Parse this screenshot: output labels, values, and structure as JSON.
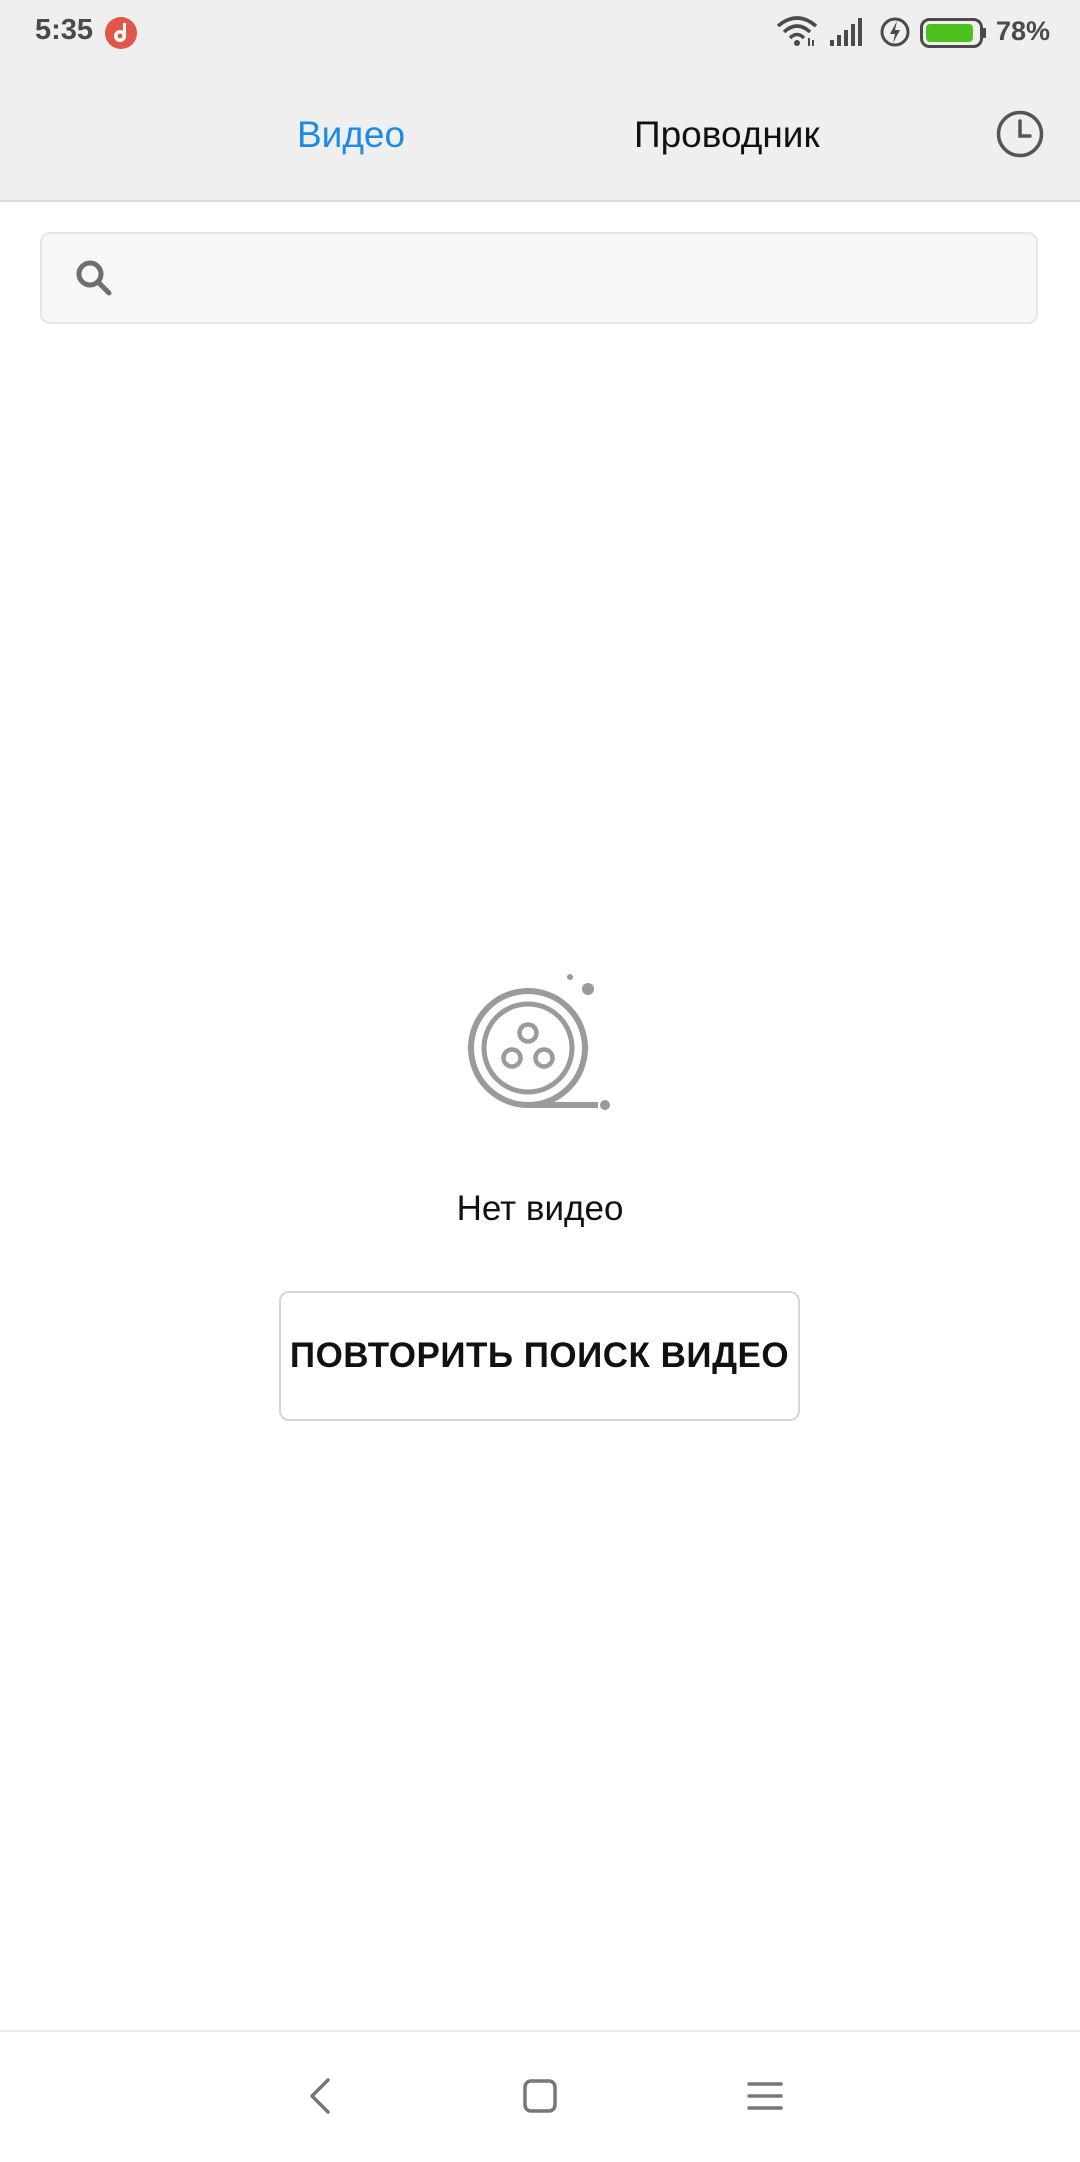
{
  "status_bar": {
    "time": "5:35",
    "battery": "78%",
    "icons": [
      "music-notification-icon",
      "wifi-icon",
      "cellular-signal-icon",
      "charging-icon",
      "battery-icon"
    ],
    "battery_color": "#4cc21c"
  },
  "header": {
    "tabs": [
      {
        "label": "Видео",
        "active": true
      },
      {
        "label": "Проводник",
        "active": false
      }
    ],
    "history_icon": "clock-icon",
    "accent_color": "#1f8ae6"
  },
  "search": {
    "value": "",
    "placeholder": "",
    "icon": "search-icon"
  },
  "empty_state": {
    "icon": "film-reel-icon",
    "message": "Нет видео",
    "button_label": "ПОВТОРИТЬ ПОИСК ВИДЕО"
  },
  "nav_bar": {
    "buttons": [
      "back-icon",
      "home-icon",
      "menu-icon"
    ]
  }
}
